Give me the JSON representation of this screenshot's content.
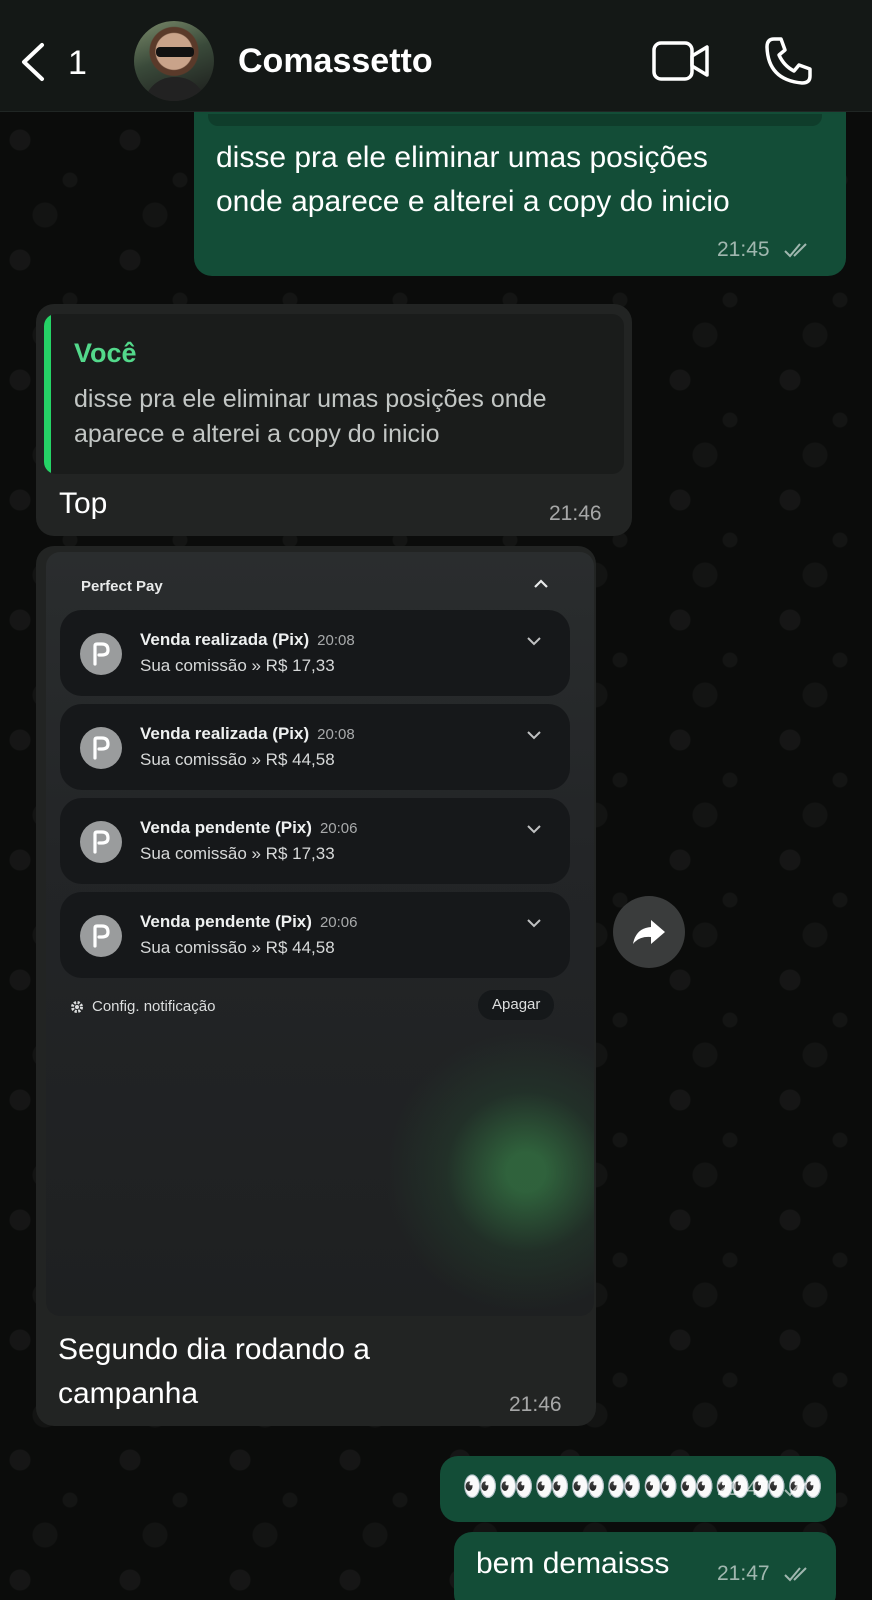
{
  "header": {
    "back_count": "1",
    "contact_name": "Comassetto"
  },
  "messages": [
    {
      "direction": "outgoing",
      "lines": [
        "disse pra ele eliminar umas posições",
        "onde aparece e alterei a copy do inicio"
      ],
      "time": "21:45",
      "status": "read"
    },
    {
      "direction": "incoming",
      "quote_author": "Você",
      "quote_text": "disse pra ele eliminar umas posições onde aparece e alterei a copy do inicio",
      "text": "Top",
      "time": "21:46"
    },
    {
      "direction": "incoming",
      "caption_lines": [
        "Segundo dia rodando a",
        "campanha"
      ],
      "time": "21:46",
      "image": {
        "app_name": "Perfect Pay",
        "notifications": [
          {
            "title": "Venda realizada (Pix)",
            "time": "20:08",
            "body": "Sua comissão » R$ 17,33"
          },
          {
            "title": "Venda realizada (Pix)",
            "time": "20:08",
            "body": "Sua comissão » R$ 44,58"
          },
          {
            "title": "Venda pendente (Pix)",
            "time": "20:06",
            "body": "Sua comissão » R$ 17,33"
          },
          {
            "title": "Venda pendente (Pix)",
            "time": "20:06",
            "body": "Sua comissão » R$ 44,58"
          }
        ],
        "config_label": "Config. notificação",
        "clear_label": "Apagar"
      }
    },
    {
      "direction": "outgoing",
      "text": "👀👀👀👀👀👀👀👀👀👀",
      "time": "21:47",
      "status": "read"
    },
    {
      "direction": "outgoing",
      "text": "bem demaisss",
      "time": "21:47",
      "status": "read"
    }
  ],
  "colors": {
    "outgoing_bubble": "#134d37",
    "incoming_bubble": "#222423",
    "quote_accent": "#25d366"
  }
}
